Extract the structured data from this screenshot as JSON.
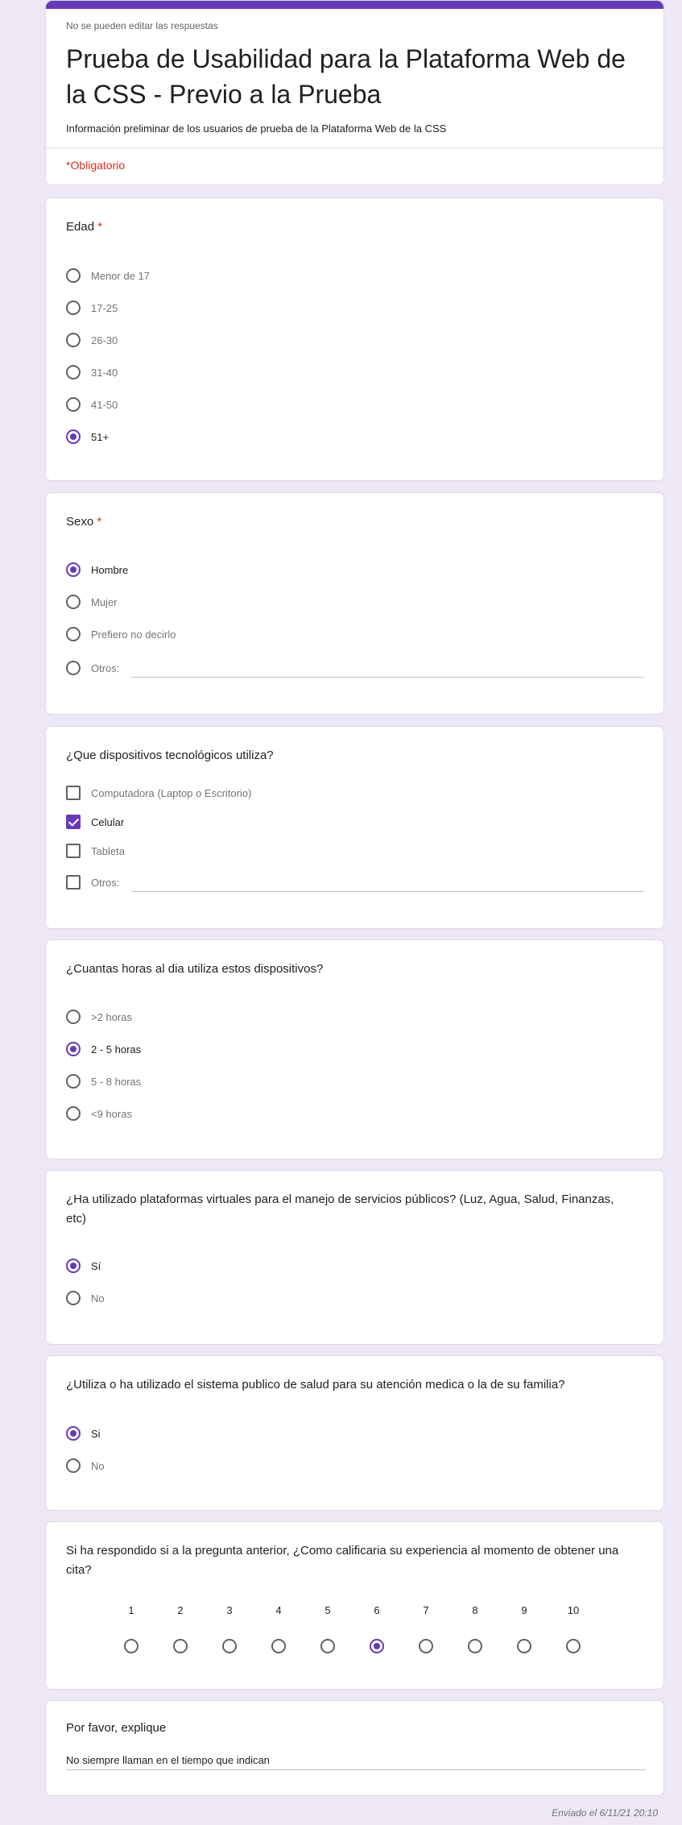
{
  "header": {
    "note": "No se pueden editar las respuestas",
    "title": "Prueba de Usabilidad para la Plataforma Web de la CSS - Previo a la Prueba",
    "description": "Información preliminar de los usuarios de prueba de la Plataforma Web de la CSS",
    "required_note": "*Obligatorio"
  },
  "age": {
    "title": "Edad",
    "star": "*",
    "options": [
      "Menor de 17",
      "17-25",
      "26-30",
      "31-40",
      "41-50",
      "51+"
    ],
    "selected": "51+"
  },
  "sex": {
    "title": "Sexo",
    "star": "*",
    "options": [
      "Hombre",
      "Mujer",
      "Prefiero no decirlo"
    ],
    "other_label": "Otros:",
    "selected": "Hombre"
  },
  "devices": {
    "title": "¿Que dispositivos tecnológicos utiliza?",
    "options": [
      "Computadora (Laptop o Escritorio)",
      "Celular",
      "Tableta"
    ],
    "other_label": "Otros:",
    "checked": [
      "Celular"
    ]
  },
  "hours": {
    "title": "¿Cuantas horas al dia utiliza estos dispositivos?",
    "options": [
      ">2 horas",
      "2 - 5 horas",
      "5 - 8 horas",
      "<9 horas"
    ],
    "selected": "2 - 5 horas"
  },
  "platforms": {
    "title": "¿Ha utilizado plataformas virtuales para el manejo de servicios públicos? (Luz, Agua, Salud, Finanzas, etc)",
    "options": [
      "Sí",
      "No"
    ],
    "selected": "Sí"
  },
  "health": {
    "title": "¿Utiliza o ha utilizado el sistema publico de salud para su atención medica o la de su familia?",
    "options": [
      "Si",
      "No"
    ],
    "selected": "Si"
  },
  "rating": {
    "title": "Si ha respondido si a la pregunta anterior, ¿Como calificaria su experiencia al momento de obtener una cita?",
    "scale": [
      "1",
      "2",
      "3",
      "4",
      "5",
      "6",
      "7",
      "8",
      "9",
      "10"
    ],
    "selected": "6"
  },
  "explain": {
    "title": "Por favor, explique",
    "answer": "No siempre llaman en el tiempo que indican"
  },
  "footer": {
    "submitted": "Enviado el 6/11/21 20:10"
  },
  "colors": {
    "accent": "#673ab7",
    "background": "#ede7f6",
    "required": "#d93025"
  }
}
